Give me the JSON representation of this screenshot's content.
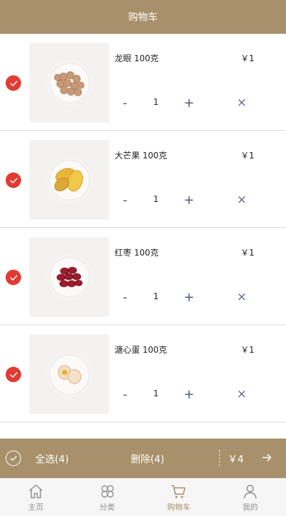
{
  "header": {
    "title": "购物车"
  },
  "cart": {
    "items": [
      {
        "name": "龙眼 100克",
        "price": "￥1",
        "quantity": "1",
        "image_icon": "longan-plate"
      },
      {
        "name": "大芒果 100克",
        "price": "￥1",
        "quantity": "1",
        "image_icon": "mango-plate"
      },
      {
        "name": "红枣 100克",
        "price": "￥1",
        "quantity": "1",
        "image_icon": "red-dates-plate"
      },
      {
        "name": "溏心蛋 100克",
        "price": "￥1",
        "quantity": "1",
        "image_icon": "soft-boiled-egg-plate"
      }
    ],
    "controls": {
      "minus": "-",
      "plus": "+",
      "remove": "×"
    }
  },
  "summary": {
    "select_all": "全选(4)",
    "delete": "删除(4)",
    "total": "￥4",
    "arrow_icon": "arrow-right-icon"
  },
  "tabbar": {
    "items": [
      {
        "label": "主页",
        "icon": "home-icon"
      },
      {
        "label": "分类",
        "icon": "category-icon"
      },
      {
        "label": "购物车",
        "icon": "cart-icon"
      },
      {
        "label": "我的",
        "icon": "profile-icon"
      }
    ],
    "active_index": 2
  },
  "colors": {
    "accent": "#a8906a",
    "check_red": "#e23b33",
    "control_blue": "#4d5a7c"
  }
}
